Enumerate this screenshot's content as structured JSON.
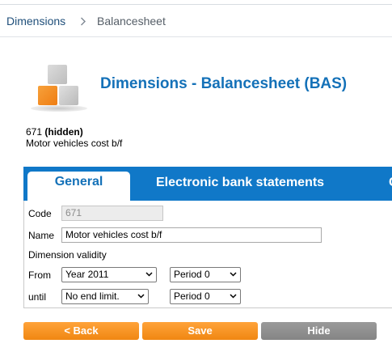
{
  "breadcrumb": {
    "parent": "Dimensions",
    "current": "Balancesheet"
  },
  "header": {
    "title": "Dimensions - Balancesheet (BAS)"
  },
  "record": {
    "code": "671",
    "status": "(hidden)",
    "name": "Motor vehicles cost b/f"
  },
  "tabs": [
    {
      "label": "General"
    },
    {
      "label": "Electronic bank statements"
    },
    {
      "label": "C"
    }
  ],
  "form": {
    "code_label": "Code",
    "code_value": "671",
    "name_label": "Name",
    "name_value": "Motor vehicles cost b/f",
    "validity_label": "Dimension validity",
    "from_label": "From",
    "from_year": "Year 2011",
    "from_period": "Period 0",
    "until_label": "until",
    "until_year": "No end limit.",
    "until_period": "Period 0"
  },
  "buttons": {
    "back": "< Back",
    "save": "Save",
    "hide": "Hide"
  },
  "colors": {
    "accent": "#1078c8",
    "button_orange": "#f08712",
    "button_grey": "#858585"
  }
}
